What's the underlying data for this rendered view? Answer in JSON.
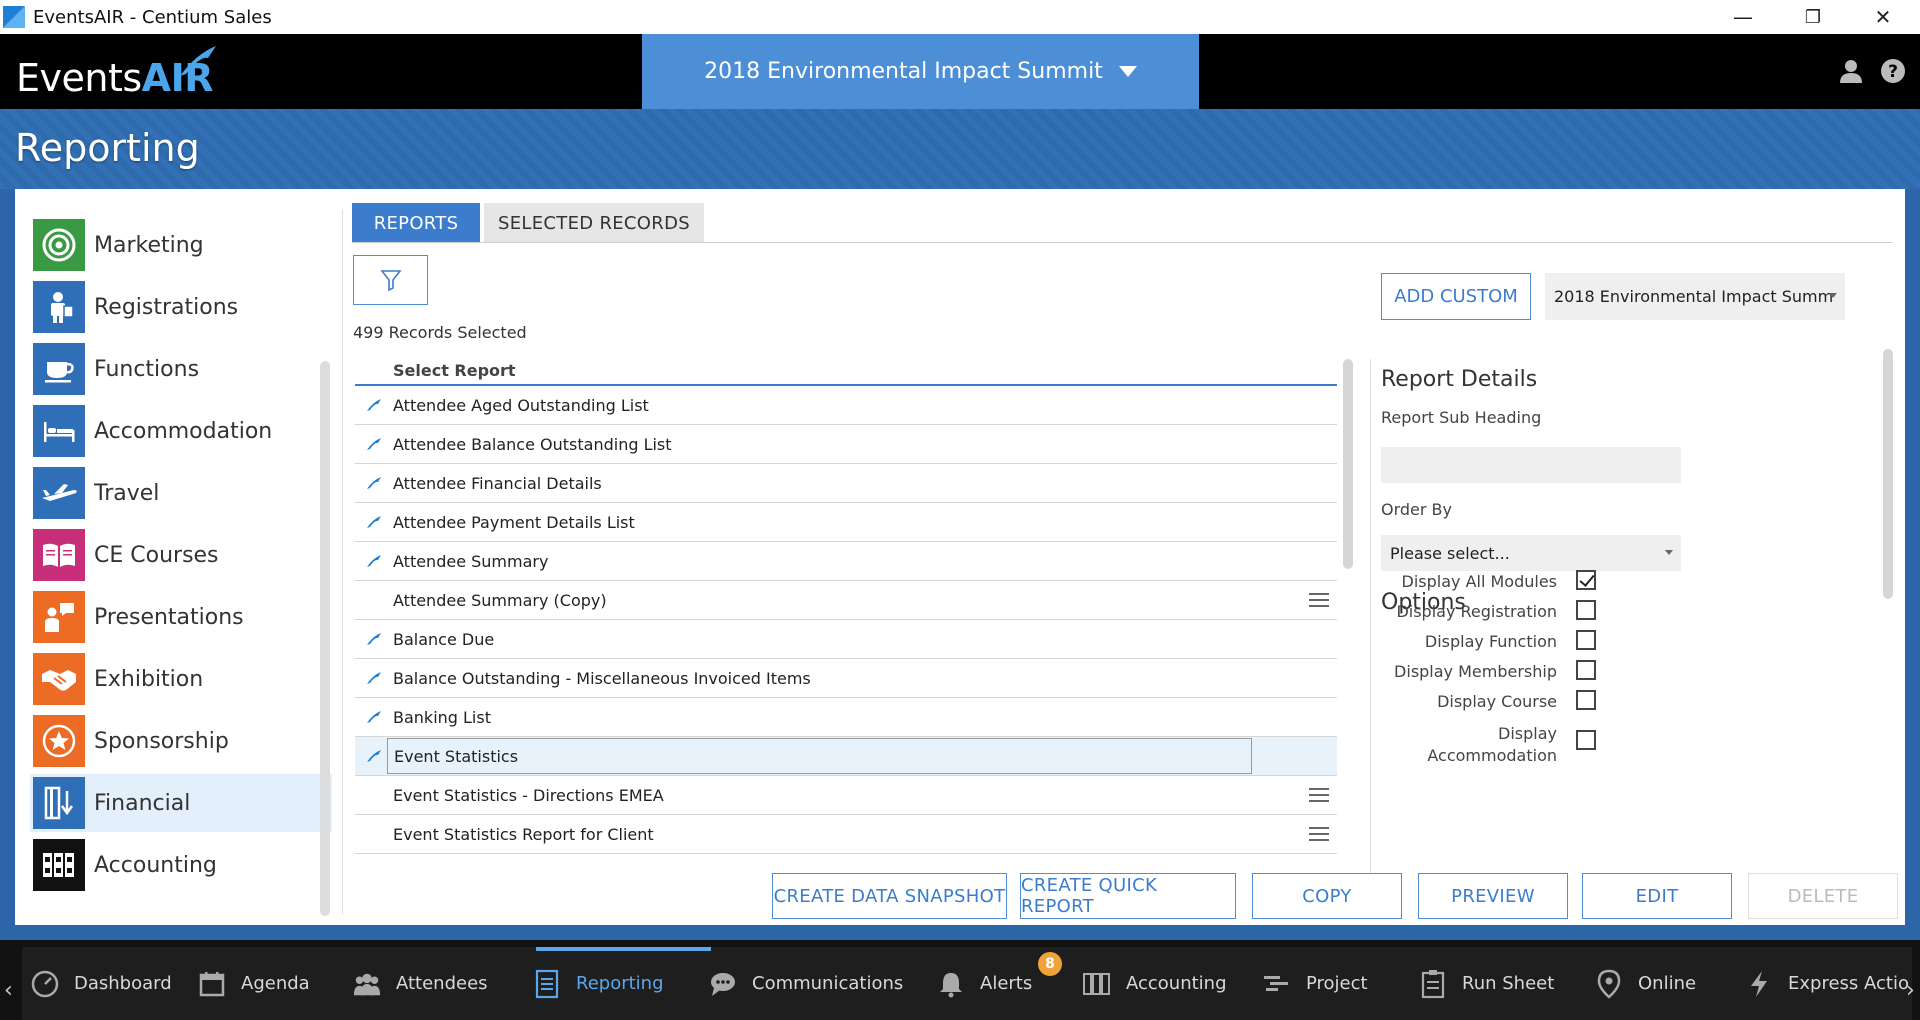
{
  "window": {
    "title": "EventsAIR - Centium Sales",
    "minimize": "—",
    "restore": "❐",
    "close": "✕"
  },
  "header": {
    "logo_events": "Events",
    "logo_air": "AIR",
    "event_name": "2018 Environmental Impact Summit",
    "user_icon": "user-icon",
    "help_icon": "help-icon"
  },
  "page": {
    "title": "Reporting"
  },
  "sidebar": {
    "items": [
      {
        "label": "Marketing",
        "icon": "target-icon",
        "color": "#3a9a44"
      },
      {
        "label": "Registrations",
        "icon": "registrations-icon",
        "color": "#2f6fb8"
      },
      {
        "label": "Functions",
        "icon": "cup-icon",
        "color": "#2f6fb8"
      },
      {
        "label": "Accommodation",
        "icon": "bed-icon",
        "color": "#2f6fb8"
      },
      {
        "label": "Travel",
        "icon": "plane-icon",
        "color": "#2f6fb8"
      },
      {
        "label": "CE Courses",
        "icon": "book-icon",
        "color": "#c82f7a"
      },
      {
        "label": "Presentations",
        "icon": "presenter-icon",
        "color": "#ec6b25"
      },
      {
        "label": "Exhibition",
        "icon": "handshake-icon",
        "color": "#ec6b25"
      },
      {
        "label": "Sponsorship",
        "icon": "star-icon",
        "color": "#ec6b25"
      },
      {
        "label": "Financial",
        "icon": "financial-icon",
        "color": "#2f6fb8"
      },
      {
        "label": "Accounting",
        "icon": "ledger-icon",
        "color": "#111111"
      }
    ],
    "active_index": 9
  },
  "tabs": [
    {
      "label": "REPORTS",
      "active": true
    },
    {
      "label": "SELECTED RECORDS",
      "active": false
    }
  ],
  "records_selected": "499 Records Selected",
  "report_list": {
    "header": "Select Report",
    "rows": [
      {
        "label": "Attendee Aged Outstanding List",
        "system": true,
        "menu": false
      },
      {
        "label": "Attendee Balance Outstanding List",
        "system": true,
        "menu": false
      },
      {
        "label": "Attendee Financial Details",
        "system": true,
        "menu": false
      },
      {
        "label": "Attendee Payment Details List",
        "system": true,
        "menu": false
      },
      {
        "label": "Attendee Summary",
        "system": true,
        "menu": false
      },
      {
        "label": "Attendee Summary (Copy)",
        "system": false,
        "menu": true
      },
      {
        "label": "Balance Due",
        "system": true,
        "menu": false
      },
      {
        "label": "Balance Outstanding - Miscellaneous Invoiced Items",
        "system": true,
        "menu": false
      },
      {
        "label": "Banking List",
        "system": true,
        "menu": false
      },
      {
        "label": "Event Statistics",
        "system": true,
        "menu": false,
        "selected": true
      },
      {
        "label": "Event Statistics - Directions EMEA",
        "system": false,
        "menu": true
      },
      {
        "label": "Event Statistics Report for Client",
        "system": false,
        "menu": true
      }
    ]
  },
  "right": {
    "add_custom": "ADD CUSTOM",
    "event_dropdown": "2018 Environmental Impact Summ",
    "report_details_title": "Report Details",
    "sub_heading_label": "Report Sub Heading",
    "sub_heading_value": "",
    "order_by_label": "Order By",
    "order_by_value": "Please select...",
    "options_title": "Options",
    "options": [
      {
        "label": "Display All Modules",
        "checked": true
      },
      {
        "label": "Display Registration",
        "checked": false
      },
      {
        "label": "Display Function",
        "checked": false
      },
      {
        "label": "Display Membership",
        "checked": false
      },
      {
        "label": "Display Course",
        "checked": false
      },
      {
        "label": "Display Accommodation",
        "checked": false
      }
    ]
  },
  "actions": {
    "create_snapshot": "CREATE DATA SNAPSHOT",
    "create_quick": "CREATE QUICK REPORT",
    "copy": "COPY",
    "preview": "PREVIEW",
    "edit": "EDIT",
    "delete": "DELETE"
  },
  "bottom_nav": {
    "items": [
      {
        "label": "Dashboard",
        "icon": "dashboard-icon"
      },
      {
        "label": "Agenda",
        "icon": "calendar-icon"
      },
      {
        "label": "Attendees",
        "icon": "people-icon"
      },
      {
        "label": "Reporting",
        "icon": "document-icon",
        "active": true
      },
      {
        "label": "Communications",
        "icon": "chat-icon"
      },
      {
        "label": "Alerts",
        "icon": "bell-icon",
        "badge": "8"
      },
      {
        "label": "Accounting",
        "icon": "ledger-icon"
      },
      {
        "label": "Project",
        "icon": "gantt-icon"
      },
      {
        "label": "Run Sheet",
        "icon": "clipboard-icon"
      },
      {
        "label": "Online",
        "icon": "location-icon"
      },
      {
        "label": "Express Actio",
        "icon": "lightning-icon"
      }
    ],
    "left_arrow": "‹",
    "right_arrow": "›"
  },
  "colors": {
    "accent": "#3b7dcc",
    "header_bg": "#000000",
    "event_bar": "#4d8fd6",
    "band": "#3271b6"
  }
}
